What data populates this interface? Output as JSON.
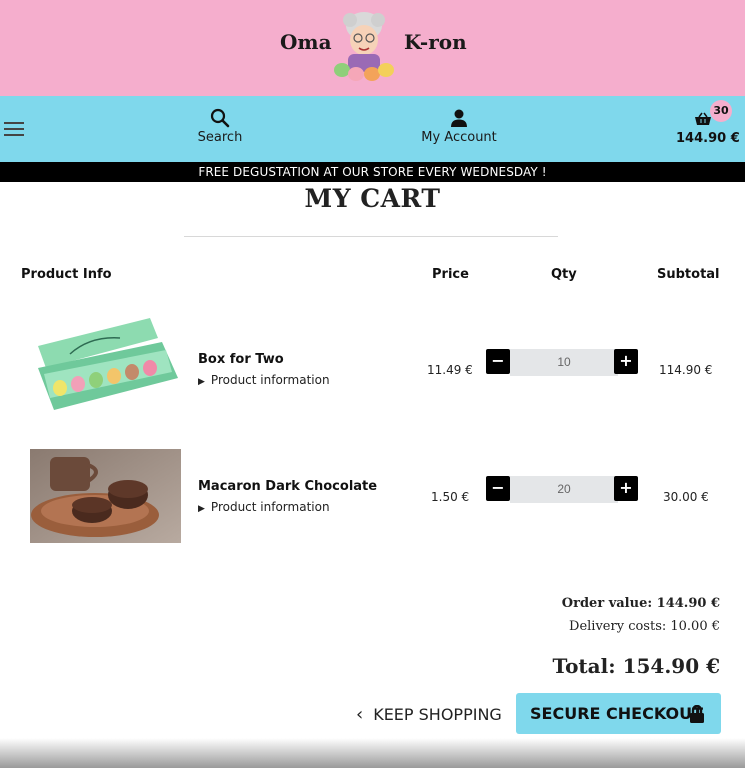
{
  "brand": {
    "left": "Oma",
    "right": "K-ron"
  },
  "nav": {
    "search_label": "Search",
    "account_label": "My Account",
    "cart_count": "30",
    "cart_total": "144.90 €"
  },
  "promo": "FREE DEGUSTATION AT OUR STORE EVERY WEDNESDAY !",
  "page_title": "MY CART",
  "table": {
    "headers": {
      "product": "Product Info",
      "price": "Price",
      "qty": "Qty",
      "subtotal": "Subtotal"
    },
    "rows": [
      {
        "name": "Box for Two",
        "info": "Product information",
        "price": "11.49 €",
        "qty": "10",
        "subtotal": "114.90 €",
        "image": "macaron-box-image"
      },
      {
        "name": "Macaron Dark Chocolate",
        "info": "Product information",
        "price": "1.50 €",
        "qty": "20",
        "subtotal": "30.00 €",
        "image": "chocolate-macaron-image"
      }
    ]
  },
  "summary": {
    "order_value": "Order value: 144.90 €",
    "delivery": "Delivery costs: 10.00 €",
    "total": "Total: 154.90 €"
  },
  "actions": {
    "keep_shopping": "KEEP SHOPPING",
    "checkout": "SECURE CHECKOUT"
  },
  "colors": {
    "pink": "#f5aecd",
    "blue": "#7fd8ec",
    "black": "#000000"
  }
}
